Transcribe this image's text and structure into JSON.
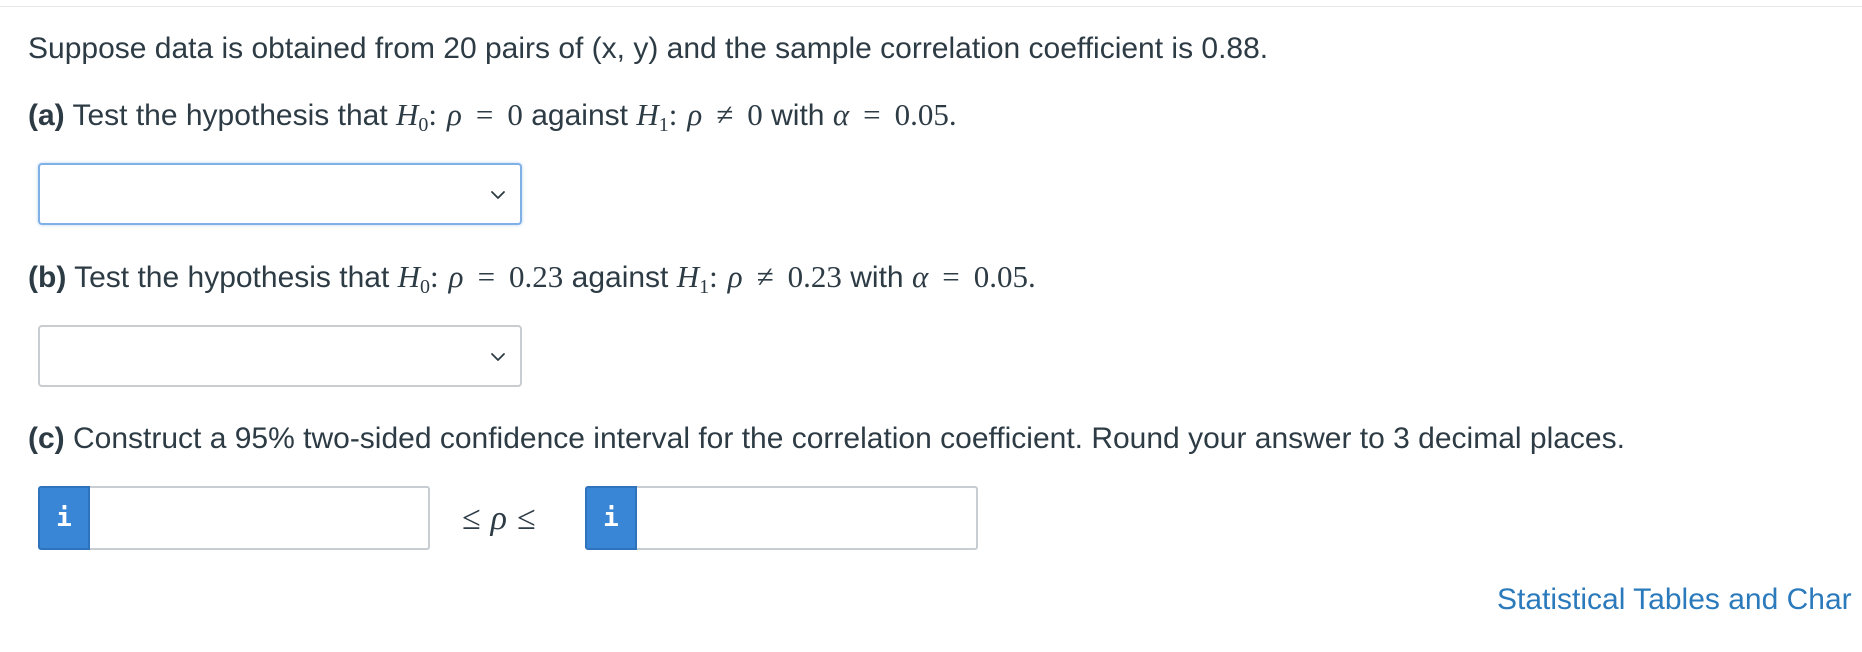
{
  "intro": "Suppose data is obtained from 20 pairs of (x, y) and the sample correlation coefficient is 0.88.",
  "part_a": {
    "label": "(a)",
    "text1": "Test the hypothesis that",
    "h0_var": "H",
    "h0_sub": "0",
    "colon": ":",
    "rho": "ρ",
    "eq": "=",
    "h0_value": "0",
    "against": "against",
    "h1_var": "H",
    "h1_sub": "1",
    "neq": "≠",
    "h1_value": "0",
    "with": "with",
    "alpha": "α",
    "alpha_value": "0.05."
  },
  "select_a": {
    "selected": ""
  },
  "part_b": {
    "label": "(b)",
    "text1": "Test the hypothesis that",
    "h0_var": "H",
    "h0_sub": "0",
    "colon": ":",
    "rho": "ρ",
    "eq": "=",
    "h0_value": "0.23",
    "against": "against",
    "h1_var": "H",
    "h1_sub": "1",
    "neq": "≠",
    "h1_value": "0.23",
    "with": "with",
    "alpha": "α",
    "alpha_value": "0.05."
  },
  "select_b": {
    "selected": ""
  },
  "part_c": {
    "label": "(c)",
    "text": "Construct a 95% two-sided confidence interval for the correlation coefficient. Round your answer to 3 decimal places."
  },
  "interval": {
    "lower_info": "i",
    "lower_value": "",
    "le1": "≤",
    "rho": "ρ",
    "le2": "≤",
    "upper_info": "i",
    "upper_value": ""
  },
  "footer_link": "Statistical Tables and Char",
  "colors": {
    "text": "#2d3b45",
    "accent": "#3a86d6",
    "link": "#2b7abc",
    "input_border": "#c7cdd1",
    "focus_border": "#7fb0e6"
  },
  "icons": {
    "dropdown": "chevron-down-icon",
    "info": "info-icon"
  }
}
